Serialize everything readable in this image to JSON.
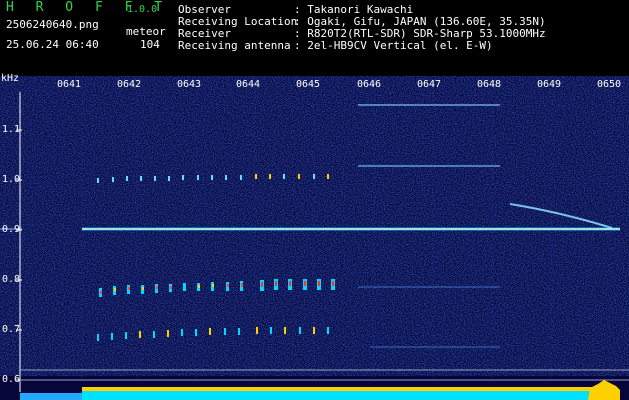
{
  "app": {
    "logo": "H R O F F T",
    "version": "1.0.0"
  },
  "file": {
    "name": "2506240640.png",
    "datetime": "25.06.24 06:40"
  },
  "meteor": {
    "label": "meteor",
    "count": "104"
  },
  "info": [
    {
      "key": "Observer",
      "value": ": Takanori Kawachi"
    },
    {
      "key": "Receiving Location",
      "value": ": Ogaki, Gifu, JAPAN (136.60E, 35.35N)"
    },
    {
      "key": "Receiver",
      "value": ": R820T2(RTL-SDR) SDR-Sharp 53.1000MHz"
    },
    {
      "key": "Receiving antenna",
      "value": ": 2el-HB9CV Vertical (el. E-W)"
    }
  ],
  "axis": {
    "unit": "kHz",
    "y_ticks": [
      "1.1",
      "1.0",
      "0.9",
      "0.8",
      "0.7",
      "0.6"
    ],
    "x_ticks": [
      "0641",
      "0642",
      "0643",
      "0644",
      "0645",
      "0646",
      "0647",
      "0648",
      "0649",
      "0650"
    ]
  },
  "colors": {
    "background": "#06063a",
    "header_text": "#ffffff",
    "logo": "#2fd64a",
    "carrier": "#a9ffe8",
    "signal_yellow": "#ffd000",
    "signal_cyan": "#00d8ff"
  }
}
